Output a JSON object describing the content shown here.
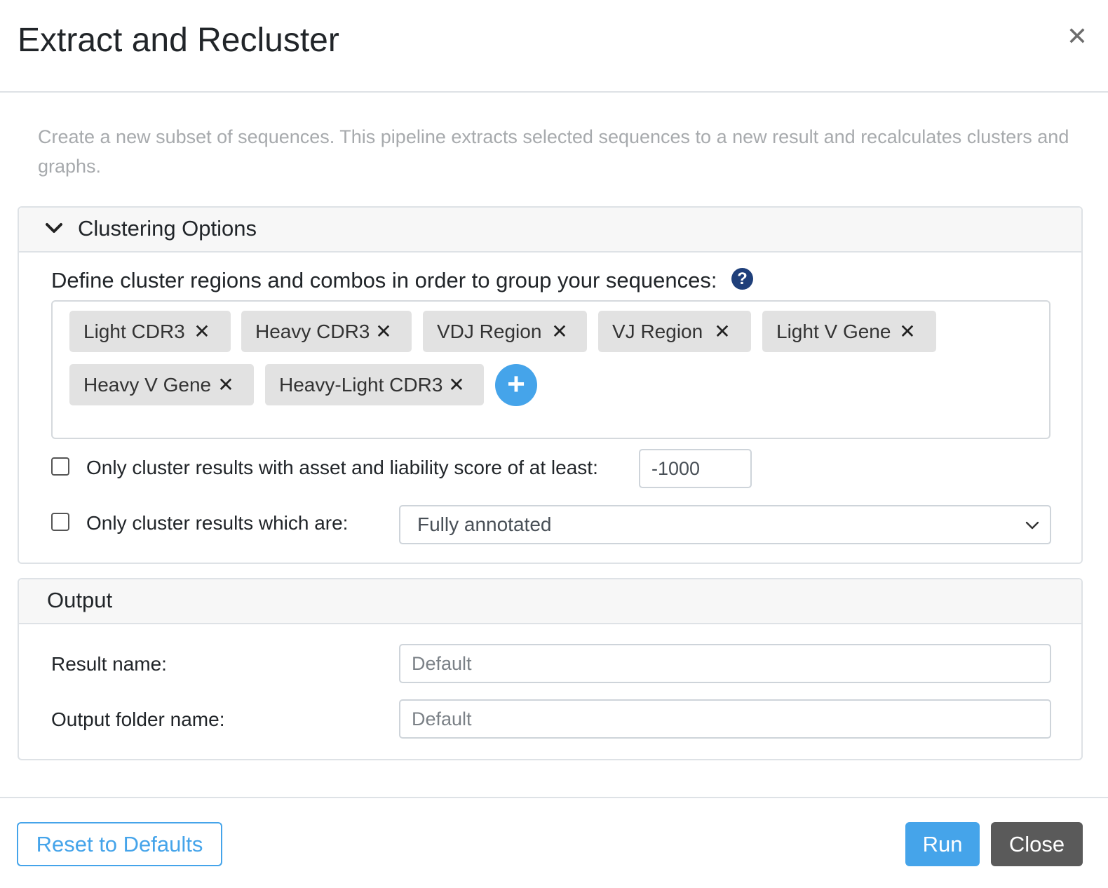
{
  "dialog": {
    "title": "Extract and Recluster",
    "close_icon": "close-icon",
    "description": "Create a new subset of sequences. This pipeline extracts selected sequences to a new result and recalculates clusters and graphs."
  },
  "clustering": {
    "title": "Clustering Options",
    "collapse_icon": "chevron-down-icon",
    "define_label": "Define cluster regions and combos in order to group your sequences:",
    "help_icon": "question-circle-icon",
    "tags": [
      "Light CDR3",
      "Heavy CDR3",
      "VDJ Region",
      "VJ Region",
      "Light V Gene",
      "Heavy V Gene",
      "Heavy-Light CDR3"
    ],
    "remove_glyph": "✕",
    "add_glyph": "+",
    "score_filter": {
      "checked": false,
      "label": "Only cluster results with asset and liability score of at least:",
      "value": "-1000"
    },
    "annotation_filter": {
      "checked": false,
      "label": "Only cluster results which are:",
      "selected": "Fully annotated"
    }
  },
  "output": {
    "title": "Output",
    "result_name_label": "Result name:",
    "result_name_placeholder": "Default",
    "folder_name_label": "Output folder name:",
    "folder_name_placeholder": "Default"
  },
  "footer": {
    "reset_label": "Reset to Defaults",
    "run_label": "Run",
    "close_label": "Close"
  },
  "colors": {
    "accent": "#45a4ea",
    "help_icon": "#1f3f7a",
    "close_button": "#5a5a5a",
    "tag_bg": "#e2e2e2",
    "description_text": "#a7aaad"
  }
}
